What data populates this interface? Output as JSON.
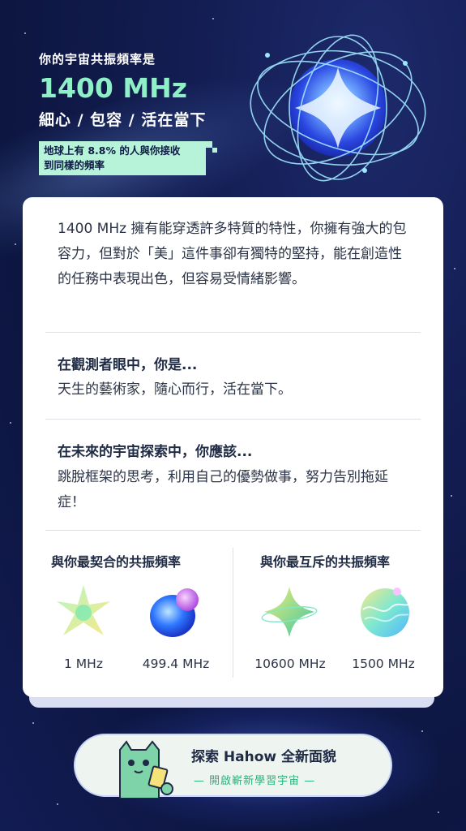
{
  "header": {
    "subtitle": "你的宇宙共振頻率是",
    "frequency": "1400 MHz",
    "traits": "細心 / 包容 / 活在當下",
    "stat_line1": "地球上有 8.8% 的人與你接收",
    "stat_line2": "到同樣的頻率"
  },
  "card": {
    "intro": "1400 MHz 擁有能穿透許多特質的特性，你擁有強大的包容力，但對於「美」這件事卻有獨特的堅持，能在創造性的任務中表現出色，但容易受情緒影響。",
    "observer_title": "在觀測者眼中，你是...",
    "observer_text": "天生的藝術家，隨心而行，活在當下。",
    "future_title": "在未來的宇宙探索中，你應該...",
    "future_text": "跳脫框架的思考，利用自己的優勢做事，努力告別拖延症！",
    "compatible_title": "與你最契合的共振頻率",
    "incompatible_title": "與你最互斥的共振頻率",
    "compatible": [
      {
        "label": "1 MHz",
        "icon": "star-planet-icon"
      },
      {
        "label": "499.4 MHz",
        "icon": "blue-blob-planet-icon"
      }
    ],
    "incompatible": [
      {
        "label": "10600 MHz",
        "icon": "ringed-star-planet-icon"
      },
      {
        "label": "1500 MHz",
        "icon": "wave-sphere-planet-icon"
      }
    ]
  },
  "cta": {
    "title": "探索 Hahow 全新面貌",
    "subtitle": "— 開啟嶄新學習宇宙 —"
  },
  "colors": {
    "accent_green": "#8ff0c8",
    "background": "#131d52",
    "cta_green": "#27b37a"
  }
}
